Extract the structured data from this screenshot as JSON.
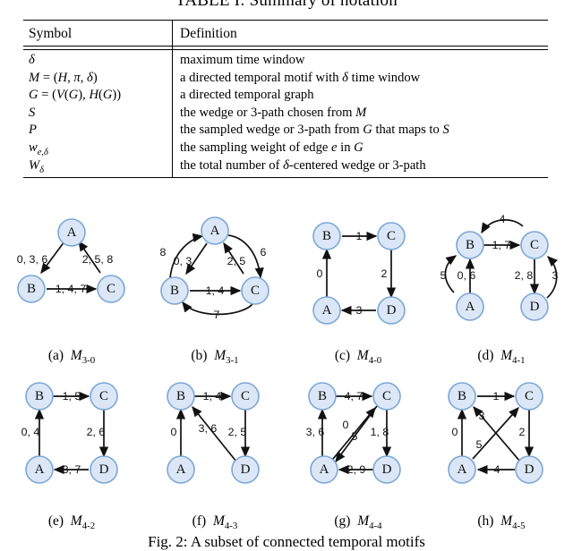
{
  "table": {
    "title": "TABLE I: Summary of notation",
    "headers": [
      "Symbol",
      "Definition"
    ],
    "rows": [
      {
        "symbol": "δ",
        "definition": "maximum time window"
      },
      {
        "symbol": "M = (H, π, δ)",
        "definition": "a directed temporal motif with δ time window"
      },
      {
        "symbol": "G = (V(G), H(G))",
        "definition": "a directed temporal graph"
      },
      {
        "symbol": "S",
        "definition": "the wedge or 3-path chosen from M"
      },
      {
        "symbol": "P",
        "definition": "the sampled wedge or 3-path from G that maps to S"
      },
      {
        "symbol": "w_{e,δ}",
        "definition": "the sampling weight of edge e in G"
      },
      {
        "symbol": "W_δ",
        "definition": "the total number of δ-centered wedge or 3-path"
      }
    ]
  },
  "figure": {
    "caption": "Fig. 2: A subset of connected temporal motifs",
    "panels": [
      {
        "id": "a",
        "label": "M",
        "sub": "3-0",
        "nodes": [
          "A",
          "B",
          "C"
        ],
        "edges": [
          {
            "from": "A",
            "to": "B",
            "times": "0, 3, 6"
          },
          {
            "from": "C",
            "to": "A",
            "times": "2, 5, 8"
          },
          {
            "from": "B",
            "to": "C",
            "times": "1, 4, 7"
          }
        ]
      },
      {
        "id": "b",
        "label": "M",
        "sub": "3-1",
        "nodes": [
          "A",
          "B",
          "C"
        ],
        "edges": [
          {
            "from": "B",
            "to": "A",
            "times": "8"
          },
          {
            "from": "A",
            "to": "B",
            "times": "0, 3"
          },
          {
            "from": "C",
            "to": "A",
            "times": "2, 5"
          },
          {
            "from": "A",
            "to": "C",
            "times": "6"
          },
          {
            "from": "B",
            "to": "C",
            "times": "1, 4"
          },
          {
            "from": "C",
            "to": "B",
            "times": "7"
          }
        ]
      },
      {
        "id": "c",
        "label": "M",
        "sub": "4-0",
        "nodes": [
          "A",
          "B",
          "C",
          "D"
        ],
        "edges": [
          {
            "from": "A",
            "to": "B",
            "times": "0"
          },
          {
            "from": "B",
            "to": "C",
            "times": "1"
          },
          {
            "from": "C",
            "to": "D",
            "times": "2"
          },
          {
            "from": "D",
            "to": "A",
            "times": "3"
          }
        ]
      },
      {
        "id": "d",
        "label": "M",
        "sub": "4-1",
        "nodes": [
          "A",
          "B",
          "C",
          "D"
        ],
        "edges": [
          {
            "from": "B",
            "to": "A",
            "times": "5"
          },
          {
            "from": "A",
            "to": "B",
            "times": "0, 6"
          },
          {
            "from": "B",
            "to": "C",
            "times": "1, 7"
          },
          {
            "from": "C",
            "to": "B",
            "times": "4"
          },
          {
            "from": "C",
            "to": "D",
            "times": "2, 8"
          },
          {
            "from": "D",
            "to": "C",
            "times": "3"
          }
        ]
      },
      {
        "id": "e",
        "label": "M",
        "sub": "4-2",
        "nodes": [
          "A",
          "B",
          "C",
          "D"
        ],
        "edges": [
          {
            "from": "A",
            "to": "B",
            "times": "0, 4"
          },
          {
            "from": "B",
            "to": "C",
            "times": "1, 5"
          },
          {
            "from": "C",
            "to": "D",
            "times": "2, 6"
          },
          {
            "from": "D",
            "to": "A",
            "times": "3, 7"
          }
        ]
      },
      {
        "id": "f",
        "label": "M",
        "sub": "4-3",
        "nodes": [
          "A",
          "B",
          "C",
          "D"
        ],
        "edges": [
          {
            "from": "A",
            "to": "B",
            "times": "0"
          },
          {
            "from": "B",
            "to": "C",
            "times": "1, 4"
          },
          {
            "from": "C",
            "to": "D",
            "times": "2, 5"
          },
          {
            "from": "D",
            "to": "B",
            "times": "3, 6"
          }
        ]
      },
      {
        "id": "g",
        "label": "M",
        "sub": "4-4",
        "nodes": [
          "A",
          "B",
          "C",
          "D"
        ],
        "edges": [
          {
            "from": "A",
            "to": "B",
            "times": "3, 6"
          },
          {
            "from": "B",
            "to": "C",
            "times": "4, 7"
          },
          {
            "from": "C",
            "to": "D",
            "times": "1, 8"
          },
          {
            "from": "D",
            "to": "A",
            "times": "2, 9"
          },
          {
            "from": "C",
            "to": "A",
            "times": "0"
          },
          {
            "from": "A",
            "to": "C",
            "times": "5"
          }
        ]
      },
      {
        "id": "h",
        "label": "M",
        "sub": "4-5",
        "nodes": [
          "A",
          "B",
          "C",
          "D"
        ],
        "edges": [
          {
            "from": "A",
            "to": "B",
            "times": "0"
          },
          {
            "from": "B",
            "to": "C",
            "times": "1"
          },
          {
            "from": "C",
            "to": "D",
            "times": "2"
          },
          {
            "from": "D",
            "to": "A",
            "times": "4"
          },
          {
            "from": "D",
            "to": "B",
            "times": "3"
          },
          {
            "from": "A",
            "to": "C",
            "times": "5"
          }
        ]
      }
    ]
  },
  "colors": {
    "node_fill": "#dbe7f6",
    "node_stroke": "#7ba7d7",
    "edge": "#111111"
  }
}
